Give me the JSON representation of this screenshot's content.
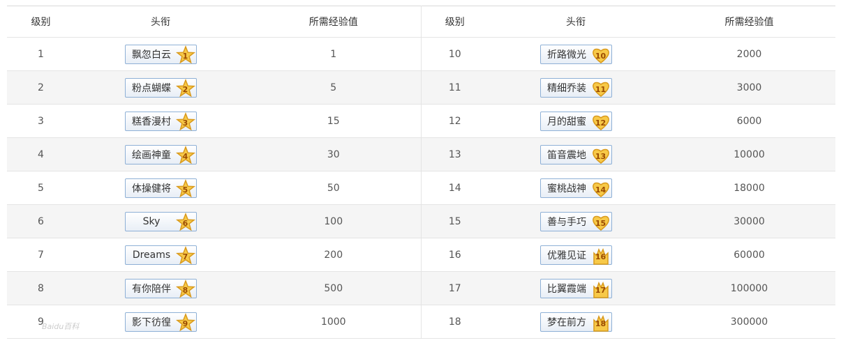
{
  "headers": {
    "level": "级别",
    "title": "头衔",
    "exp": "所需经验值"
  },
  "rows": [
    {
      "left": {
        "level": "1",
        "title": "飘忽白云",
        "badge": "1",
        "badge_shape": "star",
        "exp": "1"
      },
      "right": {
        "level": "10",
        "title": "折路微光",
        "badge": "10",
        "badge_shape": "heart",
        "exp": "2000"
      }
    },
    {
      "left": {
        "level": "2",
        "title": "粉点蝴蝶",
        "badge": "2",
        "badge_shape": "star",
        "exp": "5"
      },
      "right": {
        "level": "11",
        "title": "精细乔装",
        "badge": "11",
        "badge_shape": "heart",
        "exp": "3000"
      }
    },
    {
      "left": {
        "level": "3",
        "title": "糕香漫村",
        "badge": "3",
        "badge_shape": "star",
        "exp": "15"
      },
      "right": {
        "level": "12",
        "title": "月的甜蜜",
        "badge": "12",
        "badge_shape": "heart",
        "exp": "6000"
      }
    },
    {
      "left": {
        "level": "4",
        "title": "绘画神童",
        "badge": "4",
        "badge_shape": "star",
        "exp": "30"
      },
      "right": {
        "level": "13",
        "title": "笛音震地",
        "badge": "13",
        "badge_shape": "heart",
        "exp": "10000"
      }
    },
    {
      "left": {
        "level": "5",
        "title": "体操健将",
        "badge": "5",
        "badge_shape": "star",
        "exp": "50"
      },
      "right": {
        "level": "14",
        "title": "蜜桃战神",
        "badge": "14",
        "badge_shape": "heart",
        "exp": "18000"
      }
    },
    {
      "left": {
        "level": "6",
        "title": "Sky",
        "badge": "6",
        "badge_shape": "star",
        "exp": "100"
      },
      "right": {
        "level": "15",
        "title": "善与手巧",
        "badge": "15",
        "badge_shape": "heart",
        "exp": "30000"
      }
    },
    {
      "left": {
        "level": "7",
        "title": "Dreams",
        "badge": "7",
        "badge_shape": "star",
        "exp": "200"
      },
      "right": {
        "level": "16",
        "title": "优雅见证",
        "badge": "16",
        "badge_shape": "crown",
        "exp": "60000"
      }
    },
    {
      "left": {
        "level": "8",
        "title": "有你陪伴",
        "badge": "8",
        "badge_shape": "star",
        "exp": "500"
      },
      "right": {
        "level": "17",
        "title": "比翼霞端",
        "badge": "17",
        "badge_shape": "crown",
        "exp": "100000"
      }
    },
    {
      "left": {
        "level": "9",
        "title": "影下彷徨",
        "badge": "9",
        "badge_shape": "star",
        "exp": "1000"
      },
      "right": {
        "level": "18",
        "title": "梦在前方",
        "badge": "18",
        "badge_shape": "crown",
        "exp": "300000"
      }
    }
  ],
  "watermark": "Baidu百科",
  "colors": {
    "badge_fill": "#f7c948",
    "badge_stroke": "#d99a1c",
    "box_border": "#8eb0d6",
    "alt_row": "#f5f5f5"
  }
}
